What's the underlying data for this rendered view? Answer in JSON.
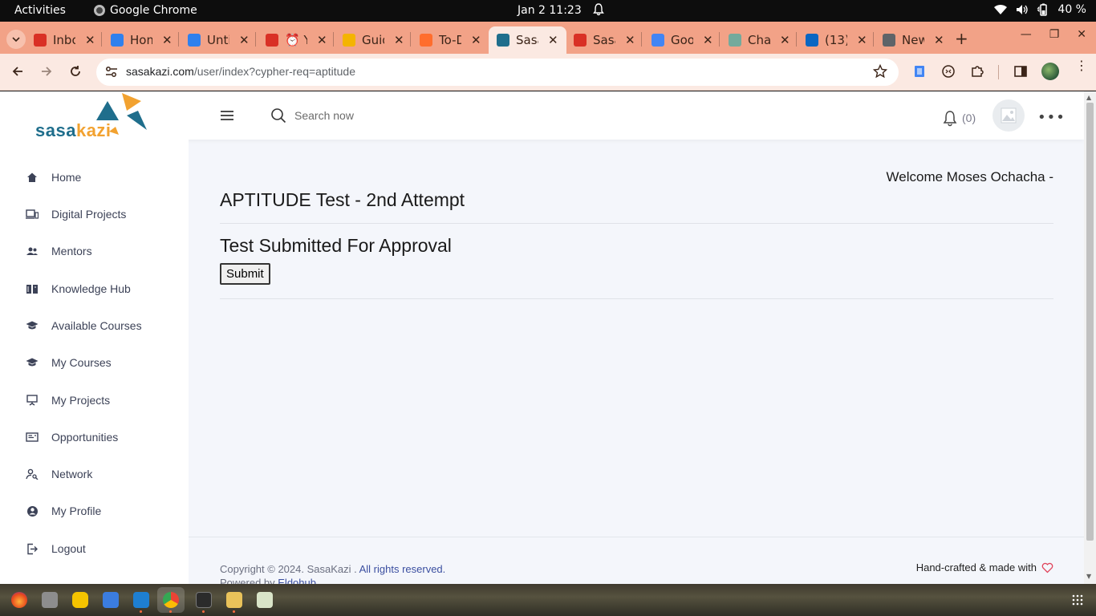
{
  "topbar": {
    "activities": "Activities",
    "app_name": "Google Chrome",
    "clock": "Jan 2  11:23",
    "battery": "40 %"
  },
  "tabs": [
    {
      "title": "Inbox",
      "favicon": "gmail-icon",
      "color": "#d93025"
    },
    {
      "title": "Home",
      "favicon": "c-logo-icon",
      "color": "#2f80ed"
    },
    {
      "title": "Untitled",
      "favicon": "c-logo-icon",
      "color": "#2f80ed"
    },
    {
      "title": "⏰ Y",
      "favicon": "gmail-icon",
      "color": "#d93025"
    },
    {
      "title": "Guide",
      "favicon": "drive-icon",
      "color": "#f4b400"
    },
    {
      "title": "To-Do",
      "favicon": "balloon-icon",
      "color": "#ff6d2d"
    },
    {
      "title": "Sasa",
      "favicon": "sasakazi-icon",
      "color": "#1f6e8c",
      "active": true
    },
    {
      "title": "Sasa",
      "favicon": "gmail-icon",
      "color": "#d93025"
    },
    {
      "title": "Goo",
      "favicon": "google-icon",
      "color": "#4285f4"
    },
    {
      "title": "Cha",
      "favicon": "chatgpt-icon",
      "color": "#74aa9c"
    },
    {
      "title": "(13)",
      "favicon": "linkedin-icon",
      "color": "#0a66c2"
    },
    {
      "title": "New",
      "favicon": "chrome-icon",
      "color": "#5f6368"
    }
  ],
  "omnibox": {
    "host": "sasakazi.com",
    "path": "/user/index?cypher-req=aptitude"
  },
  "header": {
    "logo_part1": "sasa",
    "logo_part2": "kazi",
    "search_placeholder": "Search now",
    "notif_count": "(0)"
  },
  "sidebar": {
    "items": [
      {
        "label": "Home",
        "icon": "home-icon"
      },
      {
        "label": "Digital Projects",
        "icon": "devices-icon"
      },
      {
        "label": "Mentors",
        "icon": "people-icon"
      },
      {
        "label": "Knowledge Hub",
        "icon": "book-icon"
      },
      {
        "label": "Available Courses",
        "icon": "graduation-cap-icon"
      },
      {
        "label": "My Courses",
        "icon": "graduation-cap-icon"
      },
      {
        "label": "My Projects",
        "icon": "presentation-icon"
      },
      {
        "label": "Opportunities",
        "icon": "card-icon"
      },
      {
        "label": "Network",
        "icon": "person-search-icon"
      },
      {
        "label": "My Profile",
        "icon": "account-circle-icon"
      },
      {
        "label": "Logout",
        "icon": "logout-icon"
      }
    ]
  },
  "main": {
    "welcome": "Welcome Moses Ochacha -",
    "title": "APTITUDE Test - 2nd Attempt",
    "status": "Test Submitted For Approval",
    "submit_label": "Submit"
  },
  "footer": {
    "copyright": "Copyright © 2024. SasaKazi . ",
    "rights": "All rights reserved.",
    "powered_prefix": "Powered by ",
    "powered_link": "Eldohub",
    "made_with": "Hand-crafted & made with"
  }
}
